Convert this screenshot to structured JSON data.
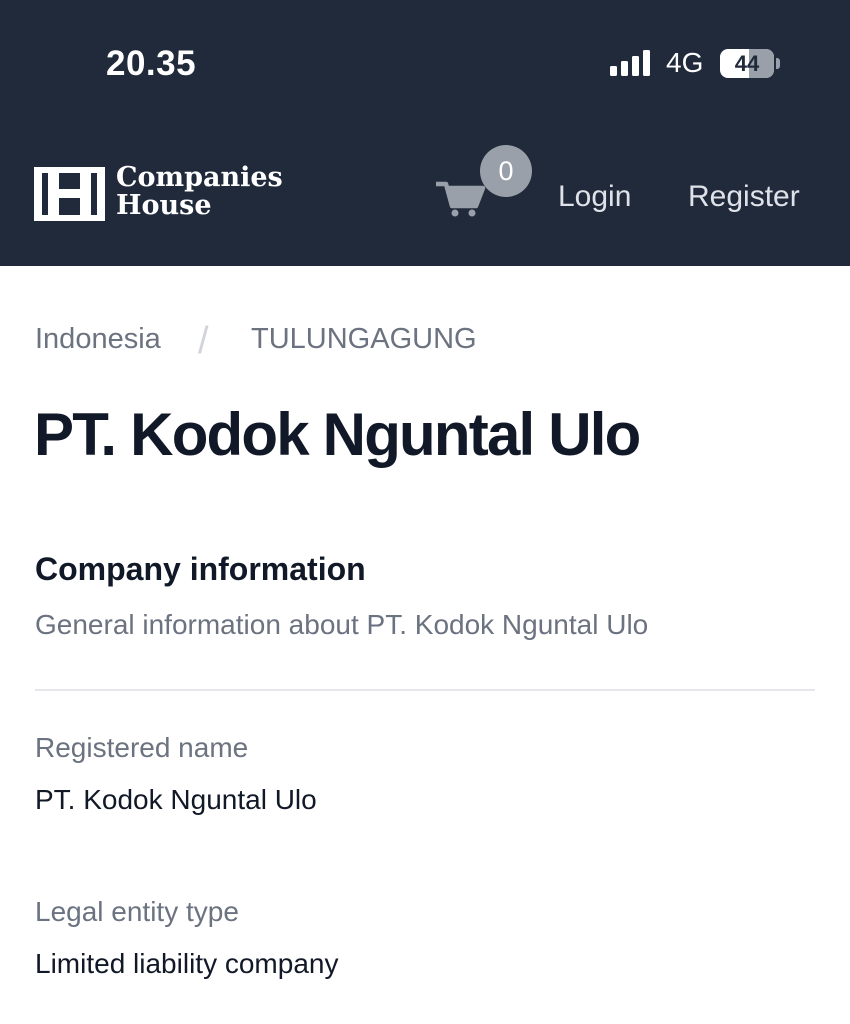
{
  "status_bar": {
    "time": "20.35",
    "network": "4G",
    "battery": "44",
    "signal_icon": "signal-bars-icon"
  },
  "header": {
    "logo": "Companies House",
    "logo_line1": "Companies",
    "logo_line2": "House",
    "cart_count": "0",
    "cart_icon": "cart-icon",
    "login": "Login",
    "register": "Register",
    "colors": {
      "background": "#212a3b",
      "badge": "#9aa0a9"
    }
  },
  "breadcrumb": {
    "country": "Indonesia",
    "separator": "/",
    "city": "TULUNGAGUNG"
  },
  "company": {
    "name": "PT. Kodok Nguntal Ulo"
  },
  "section": {
    "title": "Company information",
    "subtitle": "General information about PT. Kodok Nguntal Ulo"
  },
  "fields": [
    {
      "label": "Registered name",
      "value": "PT. Kodok Nguntal Ulo"
    },
    {
      "label": "Legal entity type",
      "value": "Limited liability company"
    }
  ]
}
